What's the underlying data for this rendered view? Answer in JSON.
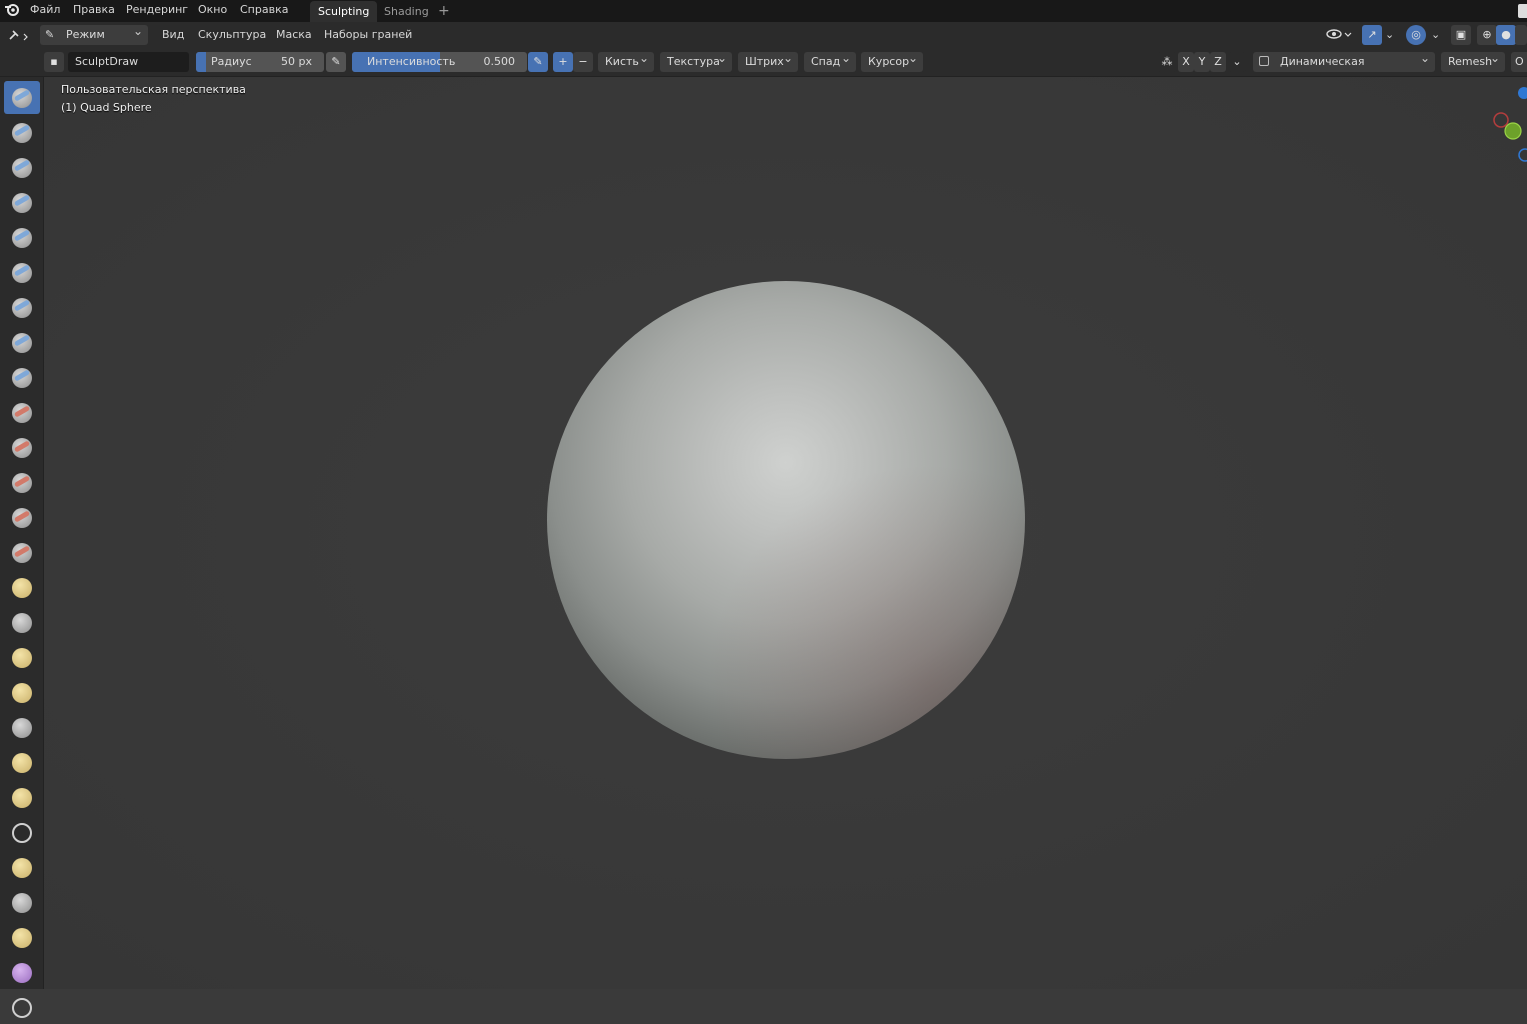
{
  "menubar": {
    "items": [
      "Файл",
      "Правка",
      "Рендеринг",
      "Окно",
      "Справка"
    ],
    "tabs": [
      "Sculpting",
      "Shading"
    ],
    "add_tab": "+"
  },
  "header": {
    "mode": "Режим скул...",
    "menus": [
      "Вид",
      "Скульптура",
      "Маска",
      "Наборы граней"
    ]
  },
  "tool_settings": {
    "brush_name": "SculptDraw",
    "radius_label": "Радиус",
    "radius_value": "50 px",
    "strength_label": "Интенсивность",
    "strength_value": "0.500",
    "strength_fraction": 0.5,
    "plus": "+",
    "minus": "−",
    "dropdowns": [
      "Кисть",
      "Текстура",
      "Штрих",
      "Спад",
      "Курсор"
    ],
    "axes": [
      "X",
      "Y",
      "Z"
    ],
    "dyntopo": "Динамическая топология",
    "remesh": "Remesh",
    "cut_label": "О"
  },
  "viewport": {
    "view_name": "Пользовательская перспектива",
    "object_name": "(1) Quad Sphere"
  },
  "colors": {
    "accent": "#4772b3",
    "background": "#3a3a3a",
    "panel": "#2b2b2b",
    "topbar": "#181818"
  },
  "toolbox": {
    "icons": [
      "draw-icon",
      "draw-sharp-icon",
      "clay-icon",
      "clay-strips-icon",
      "clay-thumb-icon",
      "layer-icon",
      "inflate-icon",
      "blob-icon",
      "crease-icon",
      "smooth-icon",
      "flatten-icon",
      "fill-icon",
      "scrape-icon",
      "multiplane-scrape-icon",
      "pinch-icon",
      "grab-icon",
      "elastic-deform-icon",
      "snake-hook-icon",
      "thumb-icon",
      "pose-icon",
      "nudge-icon",
      "rotate-icon",
      "slide-relax-icon",
      "boundary-icon",
      "cloth-icon",
      "simplify-icon",
      "mask-icon"
    ]
  }
}
